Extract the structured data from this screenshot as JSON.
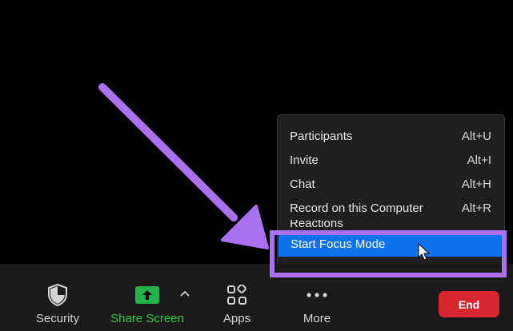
{
  "menu": {
    "items": [
      {
        "label": "Participants",
        "shortcut": "Alt+U"
      },
      {
        "label": "Invite",
        "shortcut": "Alt+I"
      },
      {
        "label": "Chat",
        "shortcut": "Alt+H"
      },
      {
        "label": "Record on this Computer",
        "shortcut": "Alt+R"
      },
      {
        "label": "Reactions",
        "shortcut": ""
      }
    ],
    "selected": {
      "label": "Start Focus Mode",
      "shortcut": ""
    }
  },
  "toolbar": {
    "security_label": "Security",
    "share_label": "Share Screen",
    "apps_label": "Apps",
    "more_label": "More",
    "end_label": "End"
  },
  "colors": {
    "background": "#000000",
    "menu_bg": "#1f1f1f",
    "toolbar_bg": "#1a1a1a",
    "selected_bg": "#0e72ed",
    "share_green": "#23b24a",
    "end_red": "#d7262e",
    "annotation_purple": "#a970f0"
  },
  "icons": {
    "security": "shield-icon",
    "share": "share-screen-arrow-icon",
    "caret": "chevron-up-icon",
    "apps": "apps-icon",
    "more": "more-dots-icon",
    "cursor": "mouse-cursor-icon",
    "annotation": "annotation-arrow"
  }
}
